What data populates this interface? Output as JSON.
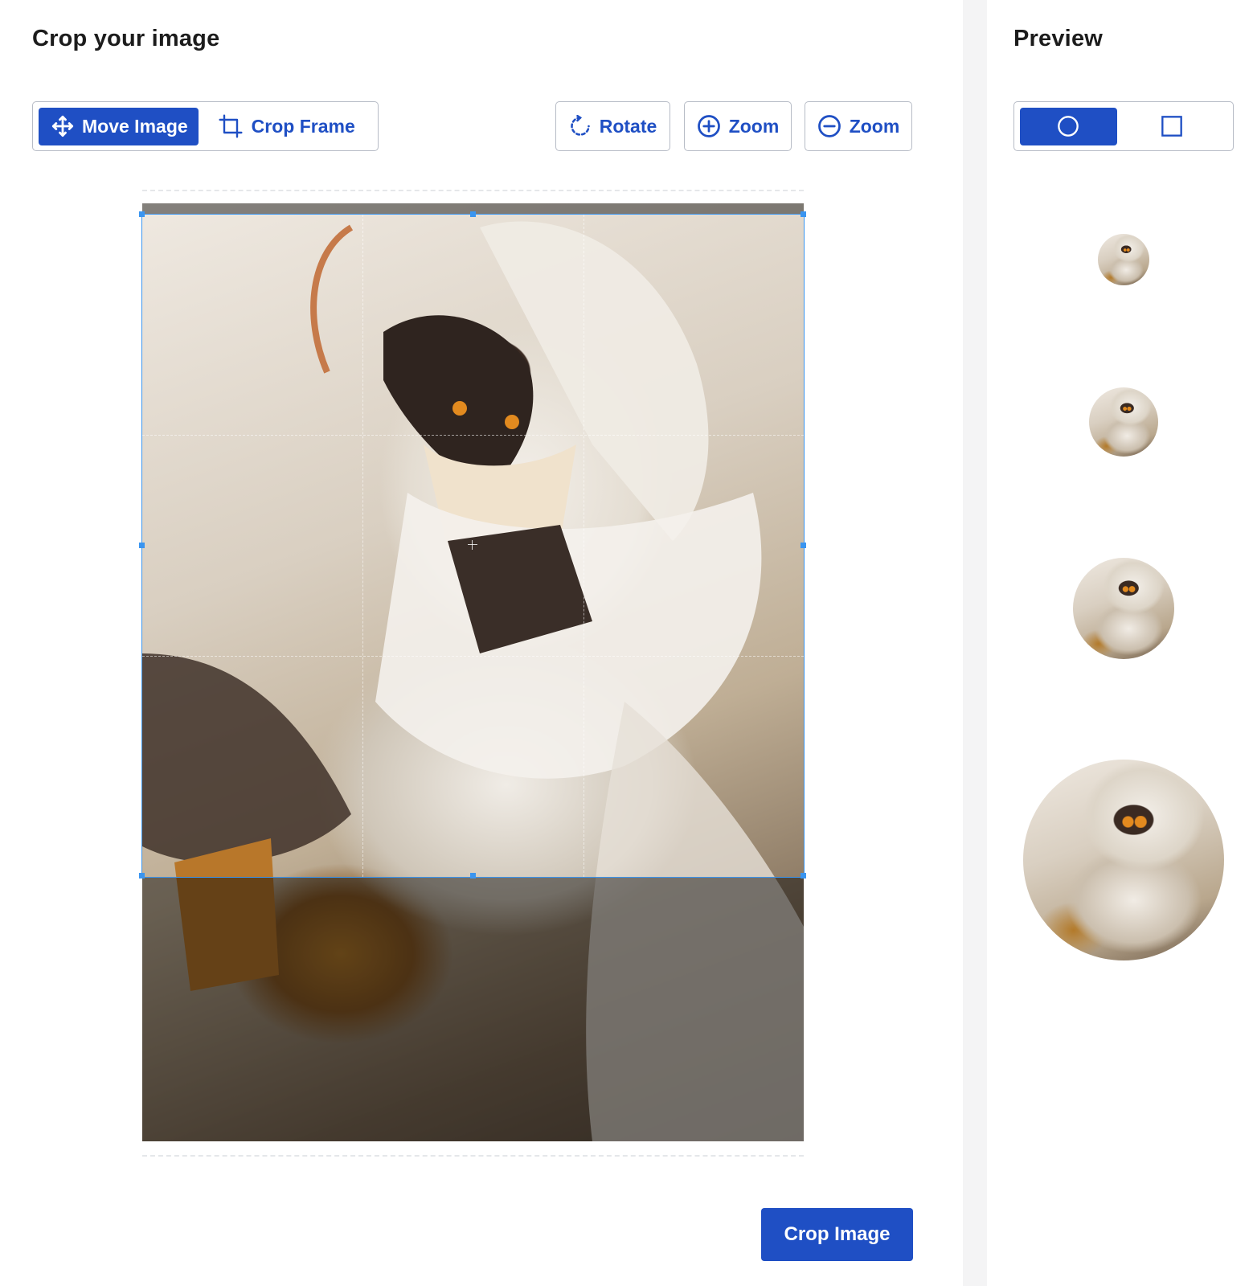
{
  "editor": {
    "title": "Crop your image",
    "mode_toggle": {
      "move_label": "Move Image",
      "crop_label": "Crop Frame",
      "active": "move"
    },
    "tools": {
      "rotate_label": "Rotate",
      "zoom_in_label": "Zoom",
      "zoom_out_label": "Zoom"
    },
    "icons": {
      "move": "move-arrows-icon",
      "crop": "crop-icon",
      "rotate": "rotate-icon",
      "zoom_in": "plus-circle-icon",
      "zoom_out": "minus-circle-icon"
    },
    "submit_label": "Crop Image"
  },
  "preview": {
    "title": "Preview",
    "shapes": [
      "circle",
      "square"
    ],
    "active_shape": "circle",
    "thumbnail_count": 4
  },
  "colors": {
    "accent": "#1f4fc4",
    "crop_frame": "#3a95f0",
    "border": "#b7bcc6"
  }
}
